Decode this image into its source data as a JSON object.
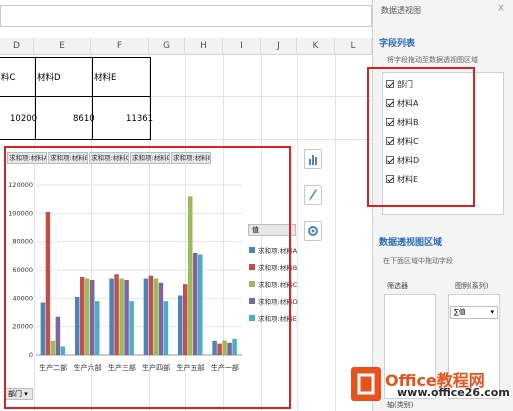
{
  "columns": [
    "D",
    "E",
    "F",
    "G",
    "H",
    "I",
    "J",
    "K",
    "L"
  ],
  "table": {
    "headers": [
      "料C",
      "材料D",
      "材料E"
    ],
    "values": [
      "10200",
      "8610",
      "11361"
    ]
  },
  "panel": {
    "title": "数据透视图",
    "close": "X",
    "field_list_title": "字段列表",
    "field_list_hint": "将字段拖动至数据透视图区域",
    "fields": [
      "部门",
      "材料A",
      "材料B",
      "材料C",
      "材料D",
      "材料E"
    ],
    "areas_title": "数据透视图区域",
    "areas_hint": "在下面区域中拖动字段",
    "filter_label": "筛选器",
    "legend_label": "图例(系列)",
    "values_item": "∑值",
    "axis_label": "轴(类别)"
  },
  "chart_tabs": [
    "求和项:材料A",
    "求和项:材料B",
    "求和项:材料C",
    "求和项:材料D",
    "求和项:材料E"
  ],
  "legend": {
    "title": "值",
    "items": [
      "求和项:材料A",
      "求和项:材料B",
      "求和项:材料C",
      "求和项:材料D",
      "求和项:材料E"
    ]
  },
  "dept_button": "部门",
  "chart_data": {
    "type": "bar",
    "categories": [
      "生产二部",
      "生产六部",
      "生产三部",
      "生产四部",
      "生产五部",
      "生产一部"
    ],
    "ylim": [
      0,
      120000
    ],
    "yticks": [
      "0",
      "20000",
      "40000",
      "60000",
      "80000",
      "100000",
      "120000"
    ],
    "series": [
      {
        "name": "求和项:材料A",
        "color": "#4f81bd",
        "values": [
          37000,
          41000,
          54000,
          54000,
          42000,
          10000
        ]
      },
      {
        "name": "求和项:材料B",
        "color": "#c0504d",
        "values": [
          101000,
          55000,
          57000,
          56000,
          50000,
          8000
        ]
      },
      {
        "name": "求和项:材料C",
        "color": "#9bbb59",
        "values": [
          10000,
          54000,
          54000,
          54000,
          112000,
          10200
        ]
      },
      {
        "name": "求和项:材料D",
        "color": "#8064a2",
        "values": [
          27000,
          53000,
          53000,
          51000,
          72000,
          8610
        ]
      },
      {
        "name": "求和项:材料E",
        "color": "#4bacc6",
        "values": [
          6000,
          38000,
          38000,
          38000,
          71000,
          11361
        ]
      }
    ]
  },
  "logo": {
    "brand": "Office教程网",
    "url": "www.office26.com"
  }
}
